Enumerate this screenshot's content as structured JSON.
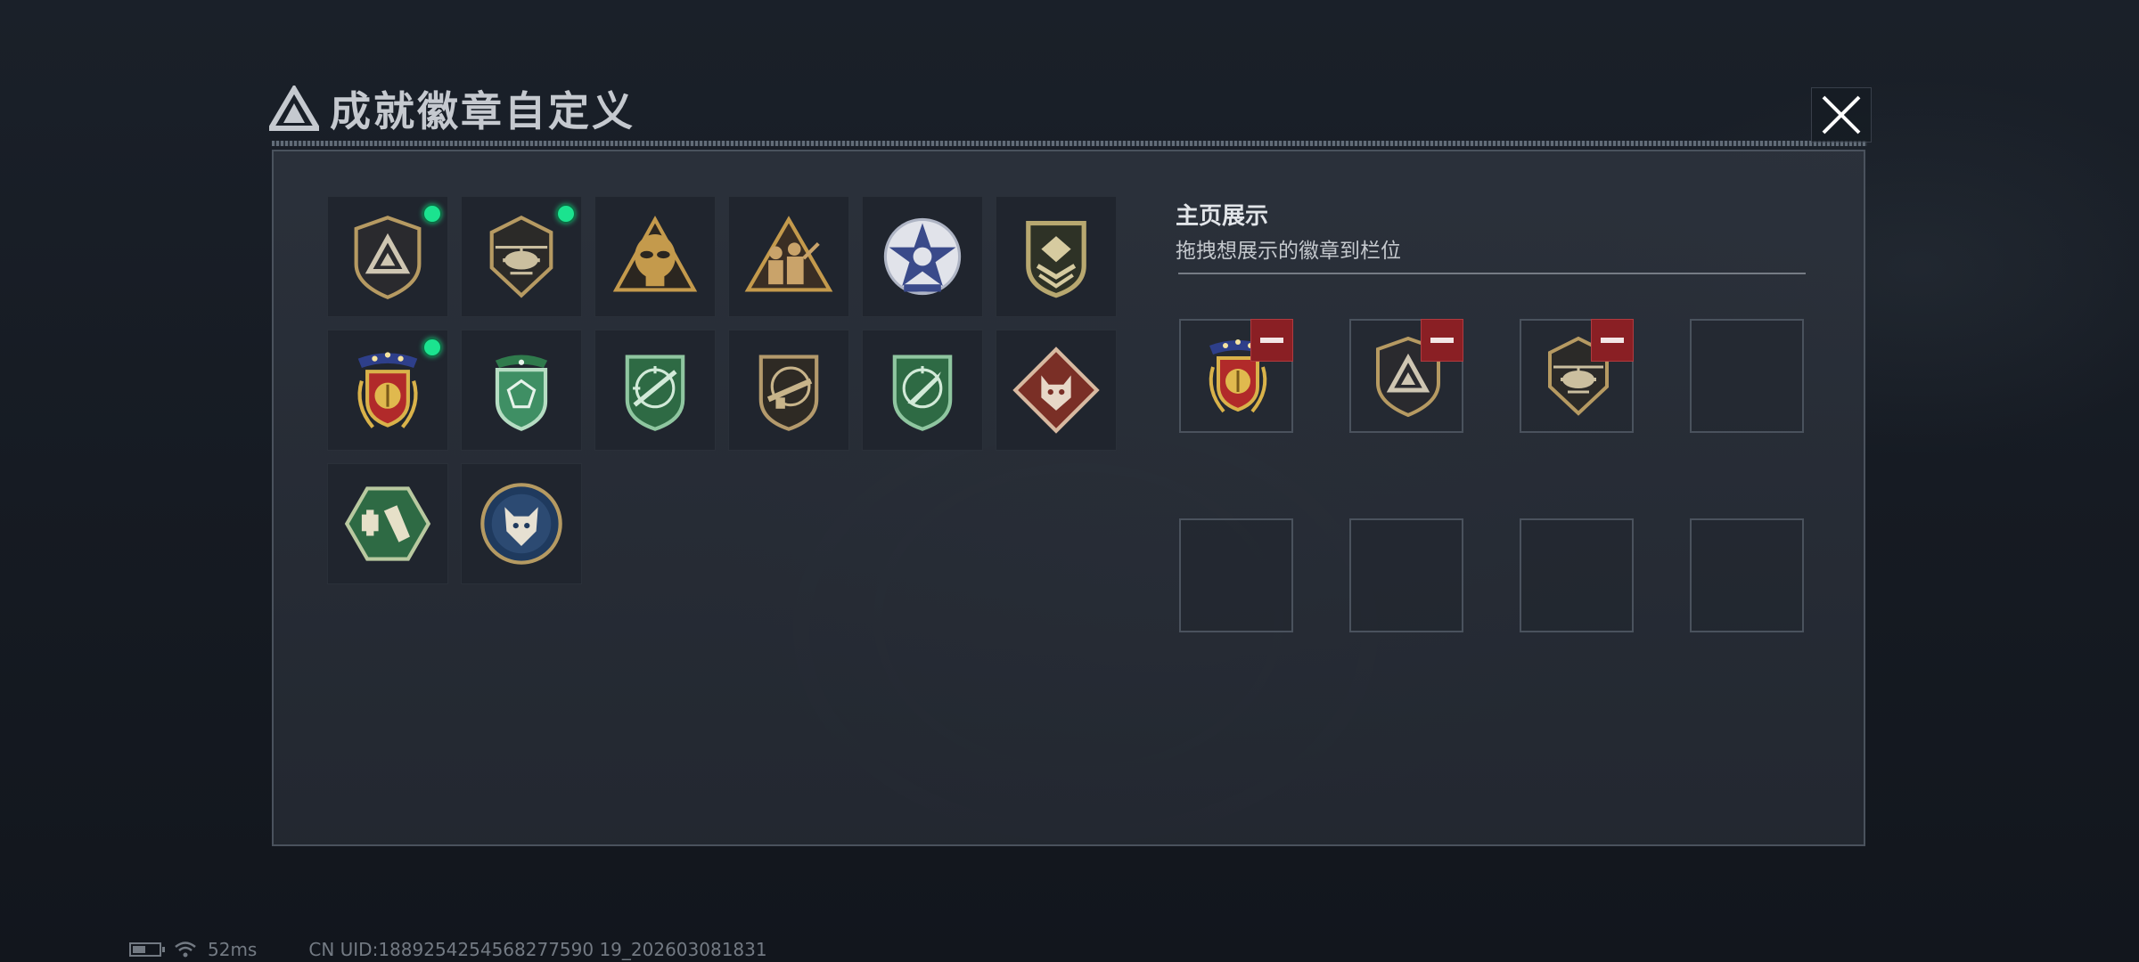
{
  "header": {
    "title": "成就徽章自定义",
    "close_icon": "close-icon"
  },
  "collection": {
    "badges": [
      {
        "name": "triangle-logo-shield-badge",
        "equipped": true
      },
      {
        "name": "helicopter-shield-badge",
        "equipped": true
      },
      {
        "name": "alien-triangle-badge",
        "equipped": false
      },
      {
        "name": "soldiers-triangle-badge",
        "equipped": false
      },
      {
        "name": "star-medallion-badge",
        "equipped": false
      },
      {
        "name": "chevron-shield-badge",
        "equipped": false
      },
      {
        "name": "laurel-stars-badge",
        "equipped": true
      },
      {
        "name": "green-gem-shield-badge",
        "equipped": false
      },
      {
        "name": "green-rifle-crosshair-badge",
        "equipped": false
      },
      {
        "name": "bronze-rifle-badge",
        "equipped": false
      },
      {
        "name": "green-knife-crosshair-badge",
        "equipped": false
      },
      {
        "name": "wolf-diamond-badge",
        "equipped": false
      },
      {
        "name": "medic-hexagon-badge",
        "equipped": false
      },
      {
        "name": "wolf-circle-badge",
        "equipped": false
      }
    ]
  },
  "showcase": {
    "title": "主页展示",
    "hint": "拖拽想展示的徽章到栏位",
    "slots": [
      {
        "badge": "laurel-stars-badge"
      },
      {
        "badge": "triangle-logo-shield-badge"
      },
      {
        "badge": "helicopter-shield-badge"
      },
      {
        "badge": null
      },
      {
        "badge": null
      },
      {
        "badge": null
      },
      {
        "badge": null
      },
      {
        "badge": null
      }
    ]
  },
  "status_bar": {
    "ping": "52ms",
    "uid": "CN UID:1889254254568277590 19_202603081831"
  },
  "colors": {
    "equipped_dot": "#1be38f",
    "remove_button": "#8a1f24",
    "panel": "#2c323c"
  }
}
